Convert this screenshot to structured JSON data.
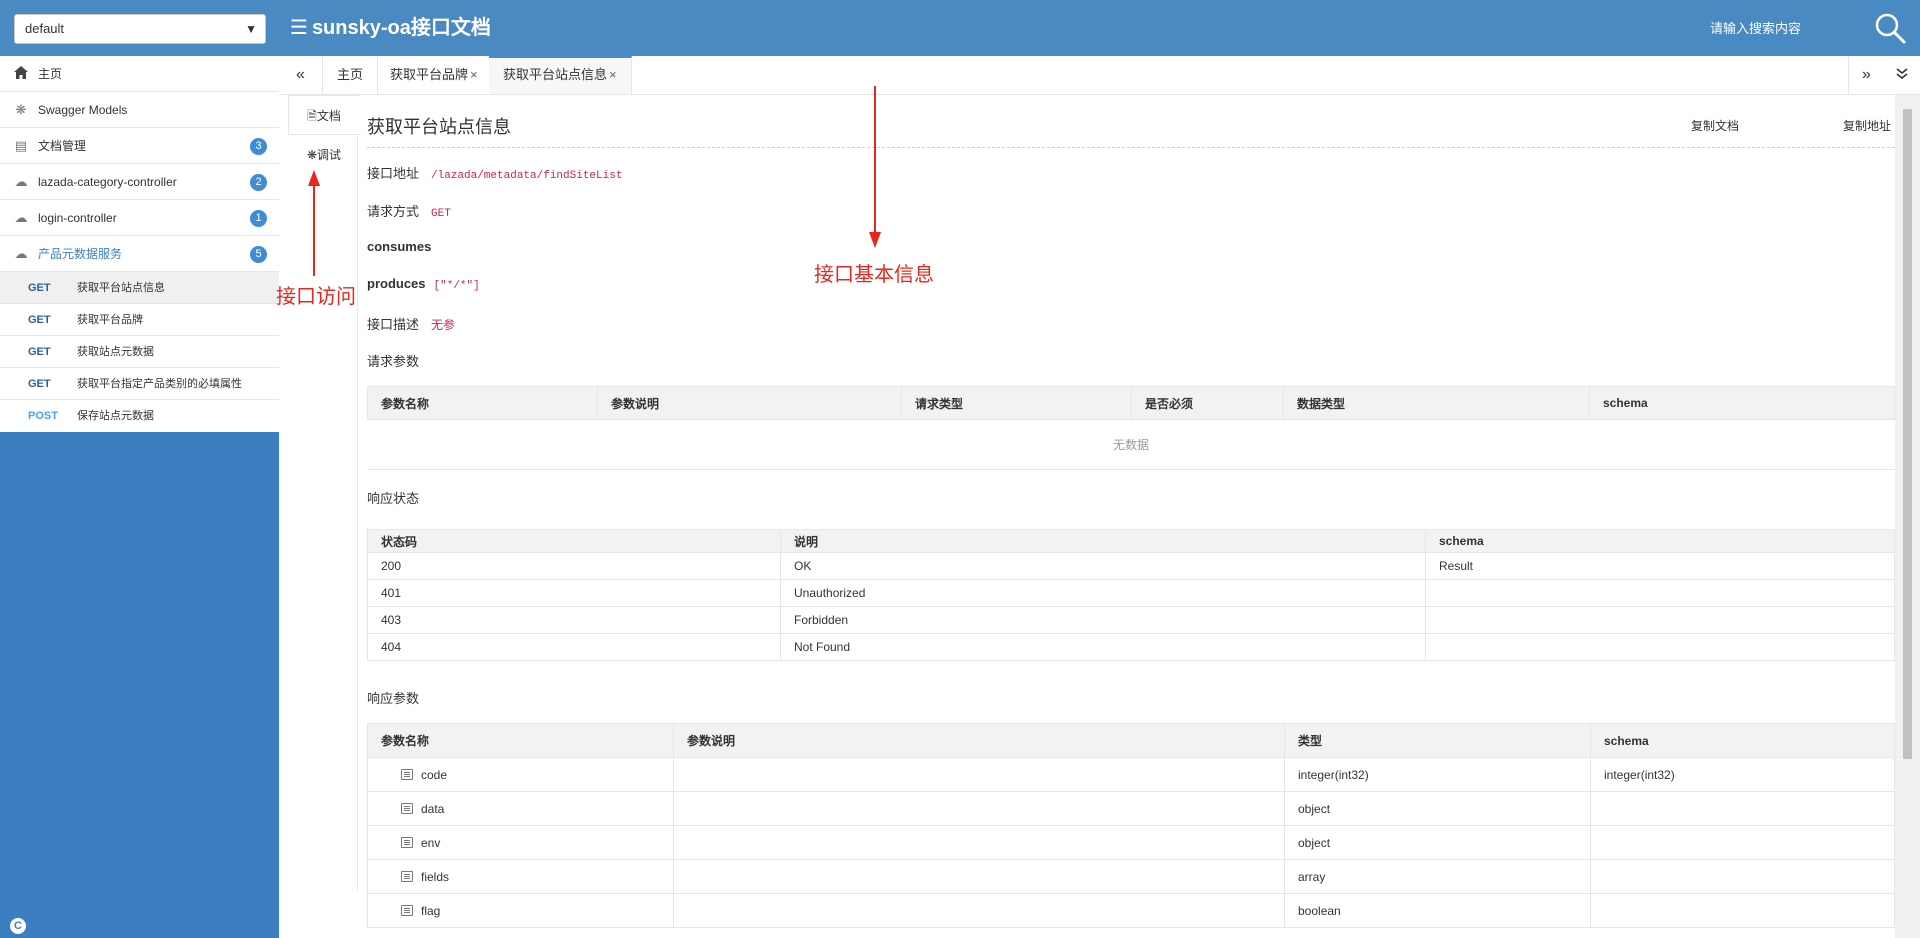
{
  "header": {
    "group_select": "default",
    "title": "sunsky-oa接口文档",
    "search_placeholder": "请输入搜索内容"
  },
  "sidebar": {
    "items": [
      {
        "label": "主页",
        "icon": "home-icon"
      },
      {
        "label": "Swagger Models",
        "icon": "models-icon"
      },
      {
        "label": "文档管理",
        "icon": "doc-icon",
        "badge": "3"
      },
      {
        "label": "lazada-category-controller",
        "icon": "cloud-icon",
        "badge": "2"
      },
      {
        "label": "login-controller",
        "icon": "cloud-icon",
        "badge": "1"
      },
      {
        "label": "产品元数据服务",
        "icon": "cloud-icon",
        "badge": "5"
      }
    ],
    "sub_items": [
      {
        "method": "GET",
        "label": "获取平台站点信息"
      },
      {
        "method": "GET",
        "label": "获取平台品牌"
      },
      {
        "method": "GET",
        "label": "获取站点元数据"
      },
      {
        "method": "GET",
        "label": "获取平台指定产品类别的必填属性"
      },
      {
        "method": "POST",
        "label": "保存站点元数据"
      }
    ],
    "footer_letter": "C"
  },
  "tabs": {
    "prev": "«",
    "next": "»",
    "dropdown": "⌄",
    "items": [
      {
        "label": "主页"
      },
      {
        "label": "获取平台品牌",
        "close": "×"
      },
      {
        "label": "获取平台站点信息",
        "close": "×"
      }
    ]
  },
  "vtabs": {
    "doc": "文档",
    "debug": "调试"
  },
  "doc": {
    "title": "获取平台站点信息",
    "copy_doc": "复制文档",
    "copy_addr": "复制地址",
    "address_label": "接口地址",
    "address": "/lazada/metadata/findSiteList",
    "method_label": "请求方式",
    "method": "GET",
    "consumes_label": "consumes",
    "produces_label": "produces",
    "produces": "[\"*/*\"]",
    "desc_label": "接口描述",
    "desc": "无参",
    "req_params_label": "请求参数",
    "req_headers": [
      "参数名称",
      "参数说明",
      "请求类型",
      "是否必须",
      "数据类型",
      "schema"
    ],
    "req_empty": "无数据",
    "resp_status_label": "响应状态",
    "status_headers": [
      "状态码",
      "说明",
      "schema"
    ],
    "status_rows": [
      [
        "200",
        "OK",
        "Result"
      ],
      [
        "401",
        "Unauthorized",
        ""
      ],
      [
        "403",
        "Forbidden",
        ""
      ],
      [
        "404",
        "Not Found",
        ""
      ]
    ],
    "resp_params_label": "响应参数",
    "resp_headers": [
      "参数名称",
      "参数说明",
      "类型",
      "schema"
    ],
    "resp_rows": [
      [
        "code",
        "",
        "integer(int32)",
        "integer(int32)"
      ],
      [
        "data",
        "",
        "object",
        ""
      ],
      [
        "env",
        "",
        "object",
        ""
      ],
      [
        "fields",
        "",
        "array",
        ""
      ],
      [
        "flag",
        "",
        "boolean",
        ""
      ]
    ]
  },
  "annotations": {
    "access": "接口访问",
    "basic_info": "接口基本信息"
  },
  "colors": {
    "header": "#4a8ac2",
    "sidebar": "#3c7fc0",
    "badge": "#3c8dd6",
    "annotation": "#e8261d",
    "code": "#c7254e"
  }
}
